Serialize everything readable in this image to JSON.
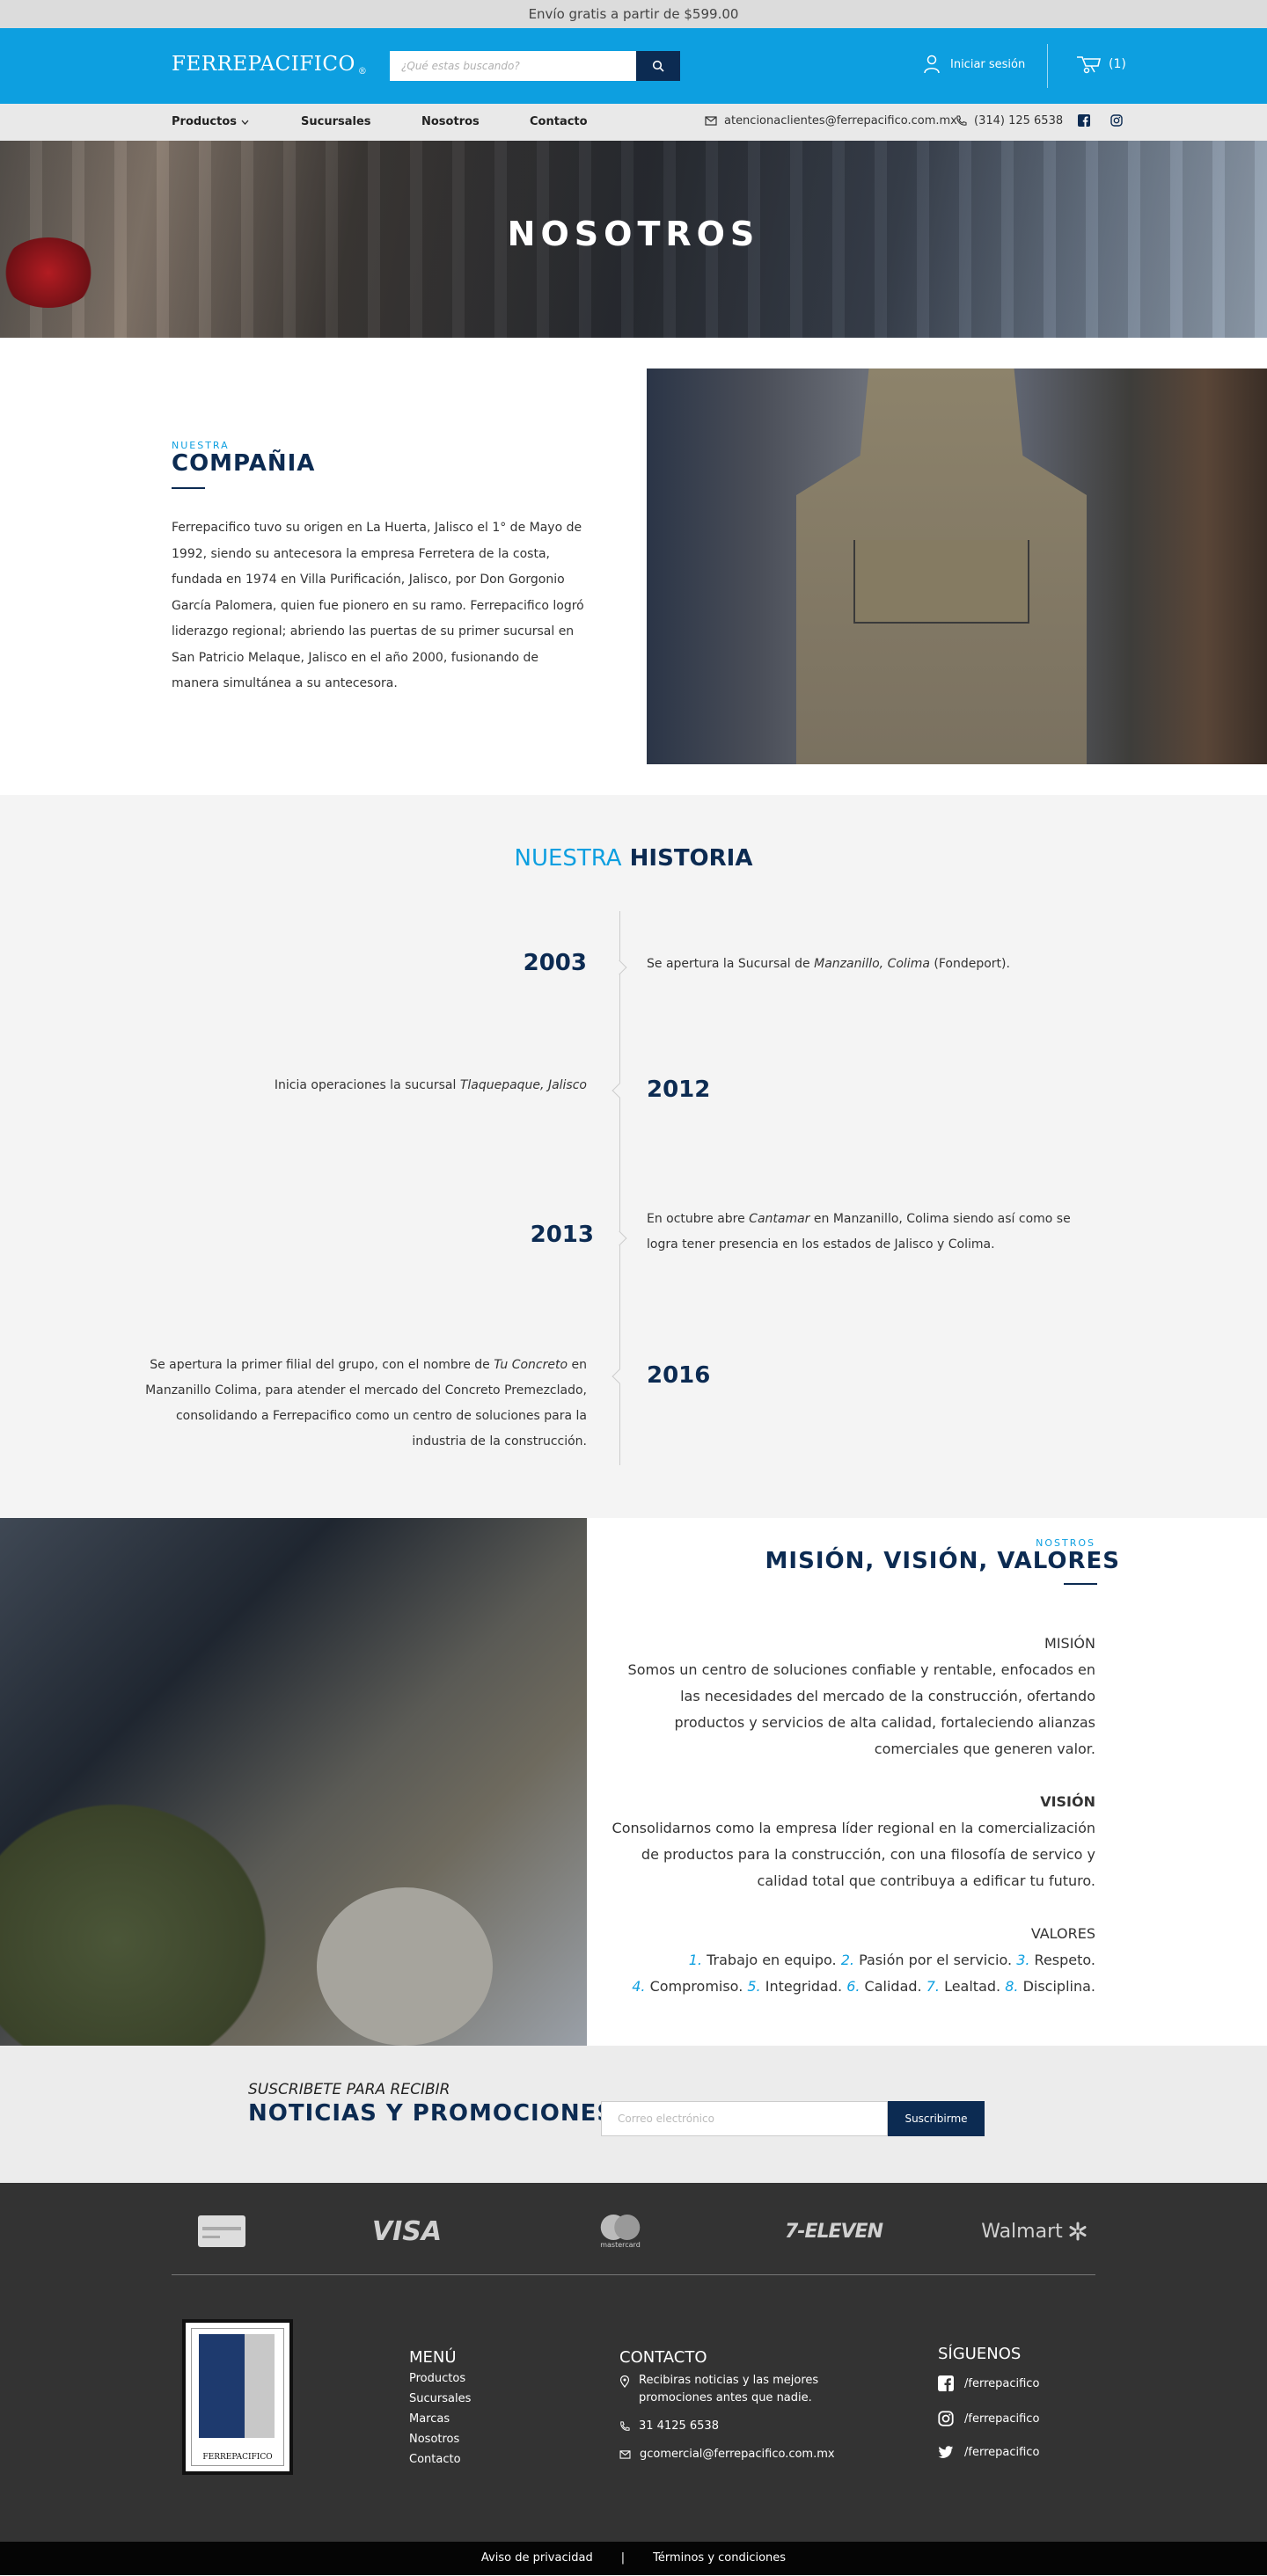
{
  "topbar": {
    "text": "Envío gratis a partir de $599.00"
  },
  "header": {
    "logo": "FERREPACIFICO",
    "logo_mark": "®",
    "search_placeholder": "¿Qué estas buscando?",
    "login_label": "Iniciar sesión",
    "cart_count": "(1)"
  },
  "nav": {
    "items": [
      "Productos",
      "Sucursales",
      "Nosotros",
      "Contacto"
    ],
    "email": "atencionaclientes@ferrepacifico.com.mx",
    "phone": "(314) 125 6538"
  },
  "hero": {
    "title": "NOSOTROS"
  },
  "company": {
    "eyebrow": "NUESTRA",
    "title": "COMPAÑIA",
    "text": "Ferrepacifico tuvo su origen en La Huerta, Jalisco el 1° de Mayo de 1992, siendo su antecesora la empresa Ferretera de la costa, fundada en 1974 en Villa Purificación, Jalisco, por Don Gorgonio García Palomera, quien fue pionero en su ramo. Ferrepacifico logró liderazgo regional; abriendo las puertas de su primer sucursal en San Patricio Melaque, Jalisco en el año 2000, fusionando de manera simultánea a su antecesora."
  },
  "history": {
    "title_accent": "NUESTRA",
    "title_main": "HISTORIA",
    "events": [
      {
        "year": "2003",
        "pre": "Se apertura la Sucursal de ",
        "em": "Manzanillo, Colima",
        "post": " (Fondeport)."
      },
      {
        "year": "2012",
        "pre": "Inicia operaciones la sucursal ",
        "em": "Tlaquepaque, Jalisco",
        "post": ""
      },
      {
        "year": "2013",
        "pre": "En octubre abre ",
        "em": "Cantamar",
        "post": " en Manzanillo, Colima siendo así como se logra tener presencia en los estados de Jalisco y Colima."
      },
      {
        "year": "2016",
        "pre": "Se apertura la primer filial del grupo, con el nombre de ",
        "em": "Tu Concreto",
        "post": " en Manzanillo Colima, para atender el mercado del Concreto Premezclado, consolidando a Ferrepacifico como un centro de soluciones para la industria de la construcción."
      }
    ]
  },
  "mvv": {
    "eyebrow": "NOSTROS",
    "title": "MISIÓN, VISIÓN, VALORES",
    "mision_label": "MISIÓN",
    "mision_text": "Somos un centro de soluciones confiable y rentable, enfocados en las necesidades del mercado de la construcción, ofertando productos y servicios de alta calidad, fortaleciendo alianzas comerciales que generen valor.",
    "vision_label": "VISIÓN",
    "vision_text": "Consolidarnos como la empresa líder regional en la comercialización de productos para la construcción, con una filosofía de servico y calidad total que contribuya a edificar tu futuro.",
    "valores_label": "VALORES",
    "valores": [
      "Trabajo en equipo.",
      "Pasión por el servicio.",
      "Respeto.",
      "Compromiso.",
      "Integridad.",
      "Calidad.",
      "Lealtad.",
      "Disciplina."
    ]
  },
  "subscribe": {
    "line1": "SUSCRIBETE PARA RECIBIR",
    "line2": "NOTICIAS Y PROMOCIONES",
    "placeholder": "Correo electrónico",
    "button": "Suscribirme"
  },
  "footer": {
    "payment": [
      "VISA",
      "mastercard",
      "7-ELEVEN",
      "Walmart"
    ],
    "logo_text": "FERREPACIFICO",
    "menu_title": "MENÚ",
    "menu": [
      "Productos",
      "Sucursales",
      "Marcas",
      "Nosotros",
      "Contacto"
    ],
    "contact_title": "CONTACTO",
    "contact_note": "Recibiras noticias y las mejores promociones antes que nadie.",
    "contact_phone": "31 4125 6538",
    "contact_email": "gcomercial@ferrepacifico.com.mx",
    "social_title": "SÍGUENOS",
    "social": [
      "/ferrepacifico",
      "/ferrepacifico",
      "/ferrepacifico"
    ]
  },
  "bottom": {
    "privacy": "Aviso de privacidad",
    "sep": "|",
    "terms": "Términos y condiciones"
  },
  "colors": {
    "brand_blue": "#0d9fe0",
    "navy": "#0c2b52",
    "footer_bg": "#333333"
  }
}
